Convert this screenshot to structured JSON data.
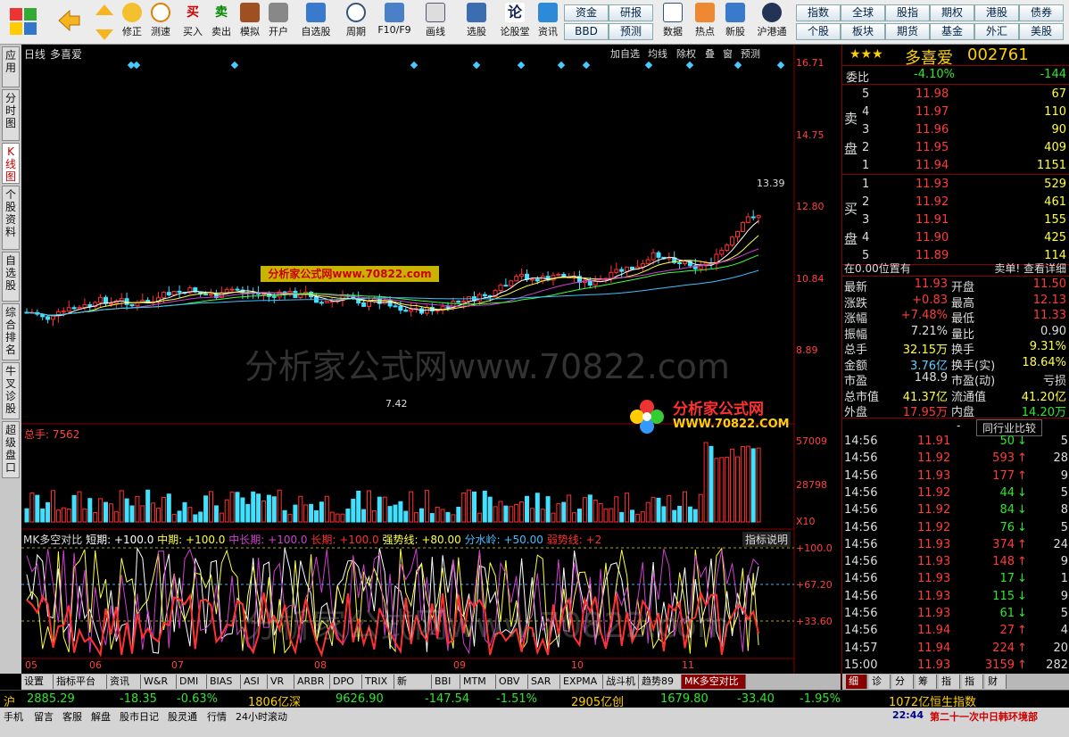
{
  "toolbar": {
    "buttons": [
      {
        "name": "back",
        "label": ""
      },
      {
        "name": "fix",
        "label": "修正"
      },
      {
        "name": "speed",
        "label": "测速"
      },
      {
        "name": "buy",
        "label": "买入",
        "glyph": "买"
      },
      {
        "name": "sell",
        "label": "卖出",
        "glyph": "卖"
      },
      {
        "name": "sim",
        "label": "模拟"
      },
      {
        "name": "open",
        "label": "开户"
      },
      {
        "name": "watchlist",
        "label": "自选股"
      },
      {
        "name": "period",
        "label": "周期"
      },
      {
        "name": "f10",
        "label": "F10/F9"
      },
      {
        "name": "draw",
        "label": "画线"
      },
      {
        "name": "pick",
        "label": "选股"
      },
      {
        "name": "forum",
        "label": "论股堂"
      },
      {
        "name": "info",
        "label": "资讯"
      },
      {
        "name": "data",
        "label": "数据"
      },
      {
        "name": "hot",
        "label": "热点"
      },
      {
        "name": "newstock",
        "label": "新股"
      },
      {
        "name": "hk",
        "label": "沪港通"
      }
    ],
    "mid_buttons": [
      "资金",
      "研报",
      "BBD",
      "预测"
    ],
    "right_buttons": [
      "指数",
      "全球",
      "股指",
      "期权",
      "港股",
      "债券",
      "个股",
      "板块",
      "期货",
      "基金",
      "外汇",
      "美股"
    ]
  },
  "left_tabs": [
    "应用",
    "分时图",
    "K线图",
    "个股资料",
    "自选股",
    "综合排名",
    "牛叉诊股",
    "超级盘口"
  ],
  "chart": {
    "period_label": "日线",
    "stock_name": "多喜爱",
    "tools": [
      "加自选",
      "均线",
      "除权",
      "叠",
      "窗",
      "预测"
    ],
    "price_axis": [
      "16.71",
      "14.75",
      "12.80",
      "10.84",
      "8.89"
    ],
    "high_label": "13.39",
    "low_label": "7.42",
    "vol_label": "总手: 7562",
    "vol_axis": [
      "57009",
      "28798",
      "X10"
    ],
    "ind_title": "MK多空对比",
    "ind_params": [
      {
        "t": "短期: +100.0",
        "c": "#fff"
      },
      {
        "t": "中期: +100.0",
        "c": "#ffff40"
      },
      {
        "t": "中长期: +100.0",
        "c": "#d040d0"
      },
      {
        "t": "长期: +100.0",
        "c": "#ff3030"
      },
      {
        "t": "强势线: +80.00",
        "c": "#ffff40"
      },
      {
        "t": "分水岭: +50.00",
        "c": "#40c0ff"
      },
      {
        "t": "弱势线: +2",
        "c": "#ff3030"
      }
    ],
    "ind_help": "指标说明",
    "ind_axis": [
      "+100.0",
      "+67.20",
      "+33.60"
    ],
    "months": [
      "05",
      "06",
      "07",
      "08",
      "09",
      "10",
      "11"
    ],
    "watermark": "分析家公式网www.70822.com",
    "banner": "分析家公式网www.70822.com",
    "logo_text": "分析家公式网",
    "logo_url": "WWW.70822.COM"
  },
  "bottom_tabs": [
    "设置",
    "指标平台",
    "资讯",
    "W&R",
    "DMI",
    "BIAS",
    "ASI",
    "VR",
    "ARBR",
    "DPO",
    "TRIX",
    "新DMA",
    "BBI",
    "MTM",
    "OBV",
    "SAR",
    "EXPMA",
    "战斗机",
    "趋势89",
    "MK多空对比"
  ],
  "quote": {
    "stars": "★★★",
    "name": "多喜爱",
    "code": "002761",
    "weibi_label": "委比",
    "weibi": "-4.10%",
    "weicha": "-144",
    "sell_label": "卖盘",
    "buy_label": "买盘",
    "sells": [
      {
        "n": "5",
        "p": "11.98",
        "v": "67"
      },
      {
        "n": "4",
        "p": "11.97",
        "v": "110"
      },
      {
        "n": "3",
        "p": "11.96",
        "v": "90"
      },
      {
        "n": "2",
        "p": "11.95",
        "v": "409"
      },
      {
        "n": "1",
        "p": "11.94",
        "v": "1151"
      }
    ],
    "buys": [
      {
        "n": "1",
        "p": "11.93",
        "v": "529"
      },
      {
        "n": "2",
        "p": "11.92",
        "v": "461"
      },
      {
        "n": "3",
        "p": "11.91",
        "v": "155"
      },
      {
        "n": "4",
        "p": "11.90",
        "v": "425"
      },
      {
        "n": "5",
        "p": "11.89",
        "v": "114"
      }
    ],
    "pos_text": "在0.00位置有",
    "pos_right": "卖单! 查看详细",
    "stats": [
      {
        "l1": "最新",
        "v1": "11.93",
        "c1": "red",
        "l2": "开盘",
        "v2": "11.50",
        "c2": "red"
      },
      {
        "l1": "涨跌",
        "v1": "+0.83",
        "c1": "red",
        "l2": "最高",
        "v2": "12.13",
        "c2": "red"
      },
      {
        "l1": "涨幅",
        "v1": "+7.48%",
        "c1": "red",
        "l2": "最低",
        "v2": "11.33",
        "c2": "red"
      },
      {
        "l1": "振幅",
        "v1": "7.21%",
        "c1": "white",
        "l2": "量比",
        "v2": "0.90",
        "c2": "white"
      },
      {
        "l1": "总手",
        "v1": "32.15万",
        "c1": "yellow",
        "l2": "换手",
        "v2": "9.31%",
        "c2": "yellow"
      },
      {
        "l1": "金额",
        "v1": "3.76亿",
        "c1": "cyan",
        "l2": "换手(实)",
        "v2": "18.64%",
        "c2": "yellow"
      },
      {
        "l1": "市盈",
        "v1": "148.9",
        "c1": "white",
        "l2": "市盈(动)",
        "v2": "亏损",
        "c2": "white"
      },
      {
        "l1": "总市值",
        "v1": "41.37亿",
        "c1": "yellow",
        "l2": "流通值",
        "v2": "41.20亿",
        "c2": "yellow"
      },
      {
        "l1": "外盘",
        "v1": "17.95万",
        "c1": "red",
        "l2": "内盘",
        "v2": "14.20万",
        "c2": "green"
      }
    ],
    "compare_btn": "同行业比较",
    "ticks": [
      {
        "t": "14:56",
        "p": "11.91",
        "v": "50",
        "d": "down",
        "n": "5"
      },
      {
        "t": "14:56",
        "p": "11.92",
        "v": "593",
        "d": "up",
        "n": "28"
      },
      {
        "t": "14:56",
        "p": "11.93",
        "v": "177",
        "d": "up",
        "n": "9"
      },
      {
        "t": "14:56",
        "p": "11.92",
        "v": "44",
        "d": "down",
        "n": "5"
      },
      {
        "t": "14:56",
        "p": "11.92",
        "v": "84",
        "d": "down",
        "n": "8"
      },
      {
        "t": "14:56",
        "p": "11.92",
        "v": "76",
        "d": "down",
        "n": "5"
      },
      {
        "t": "14:56",
        "p": "11.93",
        "v": "374",
        "d": "up",
        "n": "24"
      },
      {
        "t": "14:56",
        "p": "11.93",
        "v": "148",
        "d": "up",
        "n": "9"
      },
      {
        "t": "14:56",
        "p": "11.93",
        "v": "17",
        "d": "down",
        "n": "1"
      },
      {
        "t": "14:56",
        "p": "11.93",
        "v": "115",
        "d": "down",
        "n": "9"
      },
      {
        "t": "14:56",
        "p": "11.93",
        "v": "61",
        "d": "down",
        "n": "5"
      },
      {
        "t": "14:56",
        "p": "11.94",
        "v": "27",
        "d": "up",
        "n": "4"
      },
      {
        "t": "14:57",
        "p": "11.94",
        "v": "224",
        "d": "up",
        "n": "20"
      },
      {
        "t": "15:00",
        "p": "11.93",
        "v": "3159",
        "d": "up",
        "n": "282"
      }
    ],
    "rtabs": [
      "细",
      "诊",
      "分",
      "筹",
      "指",
      "指",
      "财"
    ]
  },
  "status": {
    "sh_label": "沪",
    "sh": "2885.29",
    "sh_chg": "-18.35",
    "sh_pct": "-0.63%",
    "sh_amt": "1806亿",
    "sz_label": "深",
    "sz": "9626.90",
    "sz_chg": "-147.54",
    "sz_pct": "-1.51%",
    "sz_amt": "2905亿",
    "cy_label": "创",
    "cy": "1679.80",
    "cy_chg": "-33.40",
    "cy_pct": "-1.95%",
    "cy_amt": "1072亿",
    "hs_label": "恒生指数"
  },
  "menubar": {
    "items": [
      "手机",
      "留言",
      "客服",
      "解盘",
      "股市日记",
      "股灵通",
      "行情",
      "24小时滚动"
    ],
    "news_time": "22:44",
    "news": "第二十一次中日韩环境部"
  }
}
